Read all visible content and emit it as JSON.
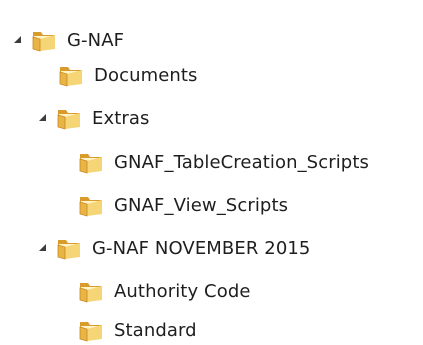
{
  "tree": {
    "items": [
      {
        "label": "G-NAF",
        "expanded": true,
        "icon": "folder-icon"
      },
      {
        "label": "Documents",
        "expanded": false,
        "icon": "folder-icon"
      },
      {
        "label": "Extras",
        "expanded": true,
        "icon": "folder-icon"
      },
      {
        "label": "GNAF_TableCreation_Scripts",
        "expanded": false,
        "icon": "folder-icon"
      },
      {
        "label": "GNAF_View_Scripts",
        "expanded": false,
        "icon": "folder-icon"
      },
      {
        "label": "G-NAF NOVEMBER 2015",
        "expanded": true,
        "icon": "folder-icon"
      },
      {
        "label": "Authority Code",
        "expanded": false,
        "icon": "folder-icon"
      },
      {
        "label": "Standard",
        "expanded": false,
        "icon": "folder-icon"
      }
    ]
  },
  "colors": {
    "folder_front": "#f3cf6a",
    "folder_back": "#e1a936",
    "folder_paper": "#fff4c7",
    "expander": "#3c3c3c",
    "text": "#1e1e1e"
  }
}
